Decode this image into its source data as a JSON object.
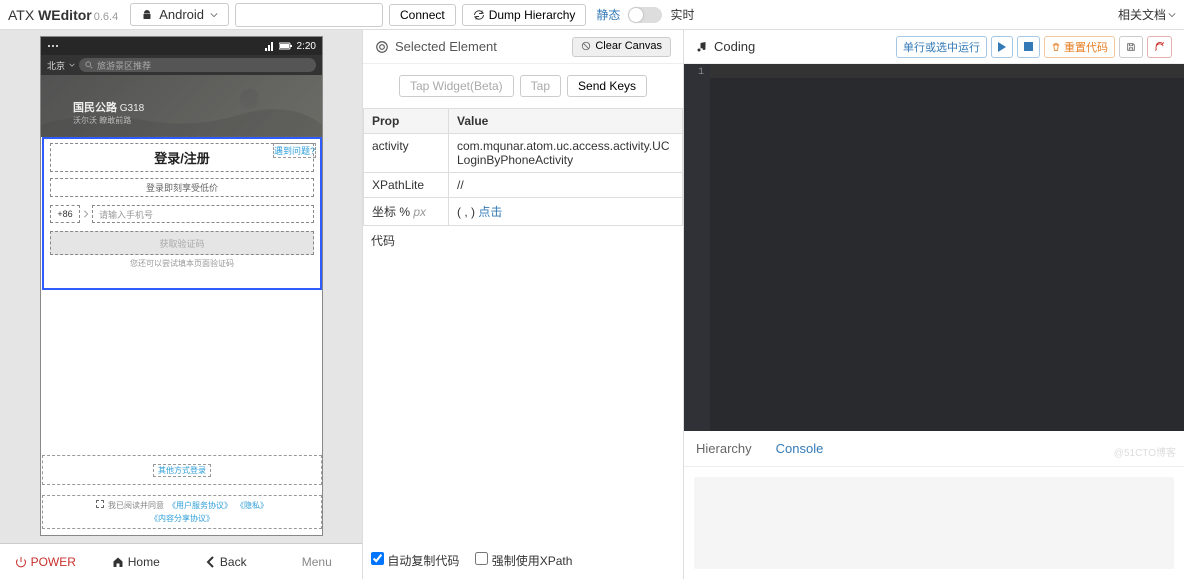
{
  "header": {
    "brand_prefix": "ATX ",
    "brand_bold": "WEditor",
    "version": "0.6.4",
    "platform": "Android",
    "connect": "Connect",
    "dump": "Dump Hierarchy",
    "mode_static": "静态",
    "mode_live": "实时",
    "docs": "相关文档"
  },
  "phone": {
    "status_time": "2:20",
    "city": "北京",
    "search_placeholder": "旅游景区推荐",
    "hero_title": "国民公路",
    "hero_num": " G318",
    "hero_sub": "沃尔沃 瞭敢前路",
    "issue_btn": "遇到问题?",
    "dialog_title": "登录/注册",
    "dialog_sub": "登录即刻享受低价",
    "country_code": "+86",
    "phone_ph": "请输入手机号",
    "get_code": "获取验证码",
    "dialog_hint": "您还可以尝试填本页面验证码",
    "other_login": "其他方式登录",
    "agree_gray": "我已阅读并同意",
    "agree_link1": "《用户服务协议》",
    "agree_link2": "《隐私》",
    "agree_link3": "《内容分享协议》"
  },
  "dev_btns": {
    "power": "POWER",
    "home": "Home",
    "back": "Back",
    "menu": "Menu"
  },
  "middle": {
    "title": "Selected Element",
    "clear": "Clear Canvas",
    "tap_widget": "Tap Widget(Beta)",
    "tap": "Tap",
    "send_keys": "Send Keys",
    "col_prop": "Prop",
    "col_value": "Value",
    "prop_activity": "activity",
    "val_activity": "com.mqunar.atom.uc.access.activity.UCLoginByPhoneActivity",
    "prop_xpathlite": "XPathLite",
    "val_xpathlite": "//",
    "prop_coord": "坐标 % ",
    "prop_coord_px": "px",
    "val_coord_paren": "( , ) ",
    "val_coord_link": "点击",
    "code_label": "代码",
    "chk1": "自动复制代码",
    "chk2": "强制使用XPath"
  },
  "right": {
    "title": "Coding",
    "run_sel": "单行或选中运行",
    "reset": "重置代码",
    "line1": "1",
    "tab_hier": "Hierarchy",
    "tab_console": "Console"
  },
  "watermark": "@51CTO博客"
}
